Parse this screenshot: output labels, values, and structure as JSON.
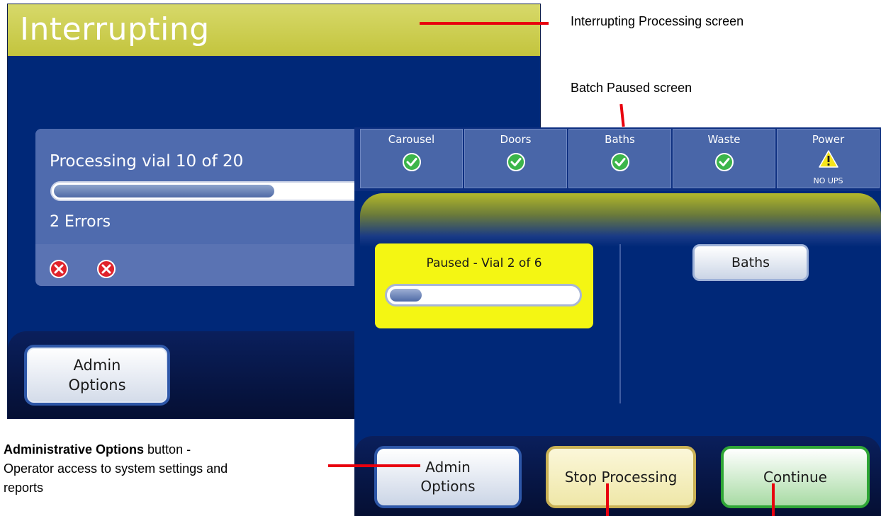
{
  "interrupting_screen": {
    "title": "Interrupting",
    "progress_text": "Processing vial 10 of 20",
    "progress_fraction": 0.5,
    "errors_text": "2 Errors",
    "error_icons": [
      "error-x-icon",
      "error-x-icon"
    ],
    "admin_button_label": "Admin\nOptions"
  },
  "batch_paused_screen": {
    "status_tiles": [
      {
        "label": "Carousel",
        "icon": "check-icon",
        "sub": ""
      },
      {
        "label": "Doors",
        "icon": "check-icon",
        "sub": ""
      },
      {
        "label": "Baths",
        "icon": "check-icon",
        "sub": ""
      },
      {
        "label": "Waste",
        "icon": "check-icon",
        "sub": ""
      },
      {
        "label": "Power",
        "icon": "warning-icon",
        "sub": "NO UPS"
      }
    ],
    "paused_text": "Paused - Vial 2 of 6",
    "paused_fraction": 0.17,
    "baths_button_label": "Baths",
    "admin_button_label": "Admin\nOptions",
    "stop_button_label": "Stop Processing",
    "continue_button_label": "Continue"
  },
  "annotations": {
    "interrupting_label": "Interrupting Processing screen",
    "batch_paused_label": "Batch Paused screen",
    "admin_bold": "Administrative Options",
    "admin_rest": " button -\nOperator access to system settings and\nreports"
  },
  "colors": {
    "screen_bg": "#002878",
    "header": "#c3c43d",
    "paused_panel": "#f4f613",
    "annotation_line": "#e8000e",
    "check_green": "#3cb54a",
    "error_red": "#e0232b"
  }
}
